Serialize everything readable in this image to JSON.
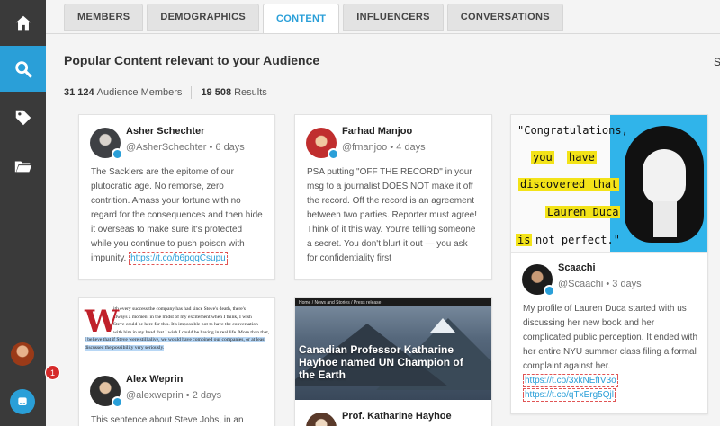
{
  "tabs": [
    {
      "label": "MEMBERS",
      "active": false
    },
    {
      "label": "DEMOGRAPHICS",
      "active": false
    },
    {
      "label": "CONTENT",
      "active": true
    },
    {
      "label": "INFLUENCERS",
      "active": false
    },
    {
      "label": "CONVERSATIONS",
      "active": false
    }
  ],
  "header": {
    "title": "Popular Content relevant to your Audience",
    "right_cut": "S"
  },
  "stats": {
    "members_count": "31 124",
    "members_label": "Audience Members",
    "results_count": "19 508",
    "results_label": "Results"
  },
  "sidebar": {
    "icons": [
      "home-icon",
      "search-icon",
      "tag-icon",
      "folder-icon"
    ],
    "active": "search-icon",
    "notification_count": "1",
    "accent": "#2a9fd8"
  },
  "cards": {
    "asher": {
      "name": "Asher Schechter",
      "handle_time": "@AsherSchechter • 6 days",
      "text": "The Sacklers are the epitome of our plutocratic age. No remorse, zero contrition. Amass your fortune with no regard for the consequences and then hide it overseas to make sure it's protected while you continue to push poison with impunity.",
      "link": "https://t.co/b6pqqCsupu"
    },
    "farhad": {
      "name": "Farhad Manjoo",
      "handle_time": "@fmanjoo • 4 days",
      "text": "PSA putting \"OFF THE RECORD\" in your msg to a journalist DOES NOT make it off the record. Off the record is an agreement between two parties. Reporter must agree! Think of it this way. You're telling someone a secret. You don't blurt it out — you ask for confidentiality first"
    },
    "scaachi": {
      "quote": [
        "\"Congratulations,",
        "you",
        "have",
        "discovered that",
        "Lauren Duca",
        "is",
        "not perfect.\""
      ],
      "name": "Scaachi",
      "handle_time": "@Scaachi • 3 days",
      "text": "My profile of Lauren Duca started with us discussing her new book and her complicated public perception. It ended with her entire NYU summer class filing a formal complaint against her.",
      "link1": "https://t.co/3xkNEfIV3o",
      "link2": "https://t.co/qTxErg5Qjl"
    },
    "alex": {
      "article_lead": "W",
      "article_lines": [
        "ith every success the company has had since Steve's death, there's",
        "always a moment in the midst of my excitement when I think, I wish",
        "Steve could be here for this. It's impossible not to have the conversation",
        "with him in my head that I wish I could be having in real life. More than that,",
        "I believe that if Steve were still alive, we would have combined our companies, or at least",
        "discussed the possibility very seriously."
      ],
      "article_highlight": "I believe",
      "name": "Alex Weprin",
      "handle_time": "@alexweprin • 2 days",
      "text": "This sentence about Steve Jobs, in an"
    },
    "katharine": {
      "news_bar": "Home  /  News and Stories  /  Press release",
      "news_title": "Canadian Professor Katharine Hayhoe named UN Champion of the Earth",
      "name": "Prof. Katharine Hayhoe"
    }
  }
}
